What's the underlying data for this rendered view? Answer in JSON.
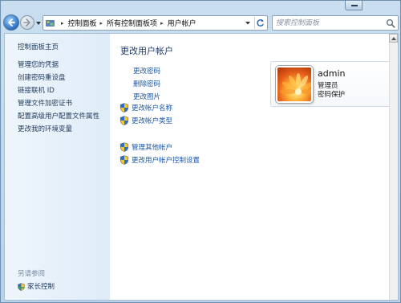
{
  "window": {
    "minimize_label": "minimize"
  },
  "nav": {
    "breadcrumbs": [
      "控制面板",
      "所有控制面板项",
      "用户帐户"
    ],
    "search_placeholder": "搜索控制面板"
  },
  "sidebar": {
    "home_link": "控制面板主页",
    "links": [
      "管理您的凭据",
      "创建密码重设盘",
      "链接联机 ID",
      "管理文件加密证书",
      "配置高级用户配置文件属性",
      "更改我的环境变量"
    ],
    "see_also": "另请参阅",
    "family_safety": "家长控制"
  },
  "main": {
    "title": "更改用户帐户",
    "tasks": [
      "更改密码",
      "删除密码",
      "更改图片"
    ],
    "shield_tasks": [
      "更改帐户名称",
      "更改帐户类型"
    ],
    "other_tasks": [
      "管理其他帐户",
      "更改用户帐户控制设置"
    ]
  },
  "account": {
    "name": "admin",
    "role": "管理员",
    "status": "密码保护"
  },
  "icons": {
    "back": "back-arrow-icon",
    "forward": "forward-arrow-icon",
    "folder": "control-panel-icon",
    "refresh": "refresh-icon",
    "search": "search-icon",
    "uac_shield": "uac-shield-icon"
  },
  "colors": {
    "link": "#1a56a8",
    "sidebar_link": "#1e3a5a",
    "title": "#1c3a6e"
  }
}
